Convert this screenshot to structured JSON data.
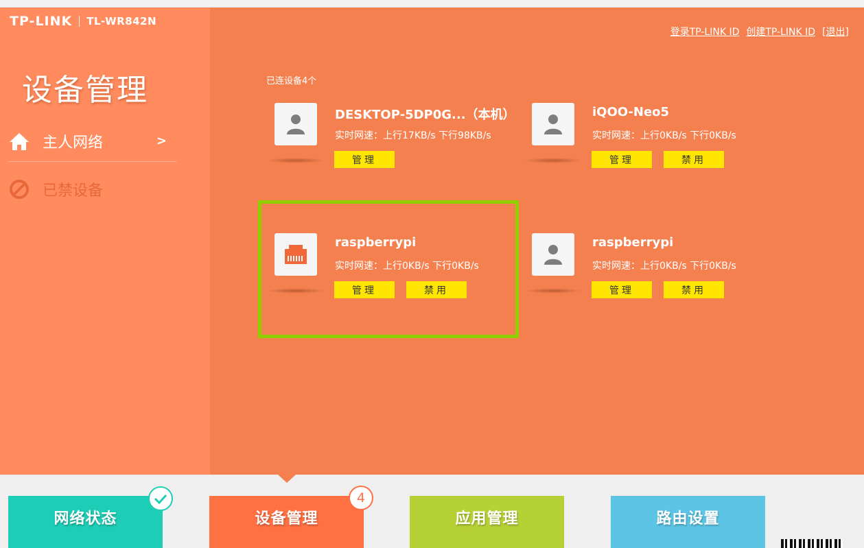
{
  "brand": {
    "logo": "TP-LINK",
    "model": "TL-WR842N"
  },
  "page_title": "设备管理",
  "nav": [
    {
      "label": "主人网络",
      "arrow": ">"
    },
    {
      "label": "已禁设备"
    }
  ],
  "top_links": {
    "login": "登录TP-LINK ID",
    "create": "创建TP-LINK ID",
    "logout": "[退出]"
  },
  "connected_count": "已连设备4个",
  "devices": [
    {
      "name": "DESKTOP-5DP0G...（本机）",
      "speed": "实时网速：上行17KB/s 下行98KB/s",
      "manage_label": "管理",
      "icon": "person-icon"
    },
    {
      "name": "iQOO-Neo5",
      "speed": "实时网速：上行0KB/s 下行0KB/s",
      "manage_label": "管理",
      "ban_label": "禁用",
      "icon": "person-icon"
    },
    {
      "name": "raspberrypi",
      "speed": "实时网速：上行0KB/s 下行0KB/s",
      "manage_label": "管理",
      "ban_label": "禁用",
      "icon": "ethernet-port-icon"
    },
    {
      "name": "raspberrypi",
      "speed": "实时网速：上行0KB/s 下行0KB/s",
      "manage_label": "管理",
      "ban_label": "禁用",
      "icon": "person-icon"
    }
  ],
  "tabs": [
    {
      "label": "网络状态",
      "color": "#1ecdb5"
    },
    {
      "label": "设备管理",
      "color": "#ff7043",
      "badge": "4"
    },
    {
      "label": "应用管理",
      "color": "#b6d136"
    },
    {
      "label": "路由设置",
      "color": "#5cc4e4"
    }
  ],
  "colors": {
    "sidebar": "#ff8b5e",
    "main": "#f4804f",
    "button": "#ffe600",
    "highlight": "#8fcf00"
  }
}
